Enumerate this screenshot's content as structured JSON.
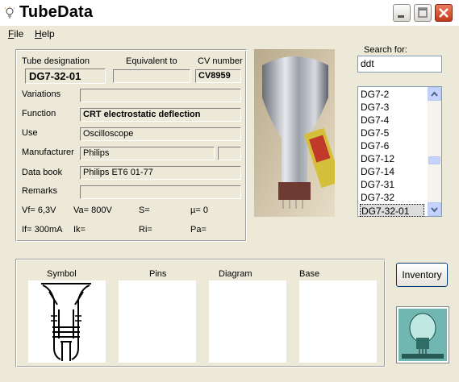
{
  "window": {
    "title": "TubeData"
  },
  "menu": {
    "file": "File",
    "help": "Help"
  },
  "details": {
    "tube_designation_label": "Tube designation",
    "tube_designation": "DG7-32-01",
    "equivalent_label": "Equivalent to",
    "equivalent": "",
    "cv_label": "CV number",
    "cv": "CV8959",
    "variations_label": "Variations",
    "variations": "",
    "function_label": "Function",
    "function": "CRT electrostatic deflection",
    "use_label": "Use",
    "use": "Oscilloscope",
    "manufacturer_label": "Manufacturer",
    "manufacturer": "Philips",
    "manufacturer_extra": "",
    "databook_label": "Data book",
    "databook": "Philips ET6  01-77",
    "remarks_label": "Remarks",
    "remarks": ""
  },
  "params": {
    "vf": "Vf= 6,3V",
    "va": "Va= 800V",
    "s": "S=",
    "mu": "µ=   0",
    "if": "If= 300mA",
    "ik": "Ik=",
    "ri": "Ri=",
    "pa": "Pa="
  },
  "search": {
    "label": "Search for:",
    "value": "ddt",
    "items": [
      "DG7-2",
      "DG7-3",
      "DG7-4",
      "DG7-5",
      "DG7-6",
      "DG7-12",
      "DG7-14",
      "DG7-31",
      "DG7-32",
      "DG7-32-01"
    ],
    "selected": "DG7-32-01"
  },
  "bottom": {
    "symbol_label": "Symbol",
    "pins_label": "Pins",
    "diagram_label": "Diagram",
    "base_label": "Base"
  },
  "inventory_label": "Inventory"
}
